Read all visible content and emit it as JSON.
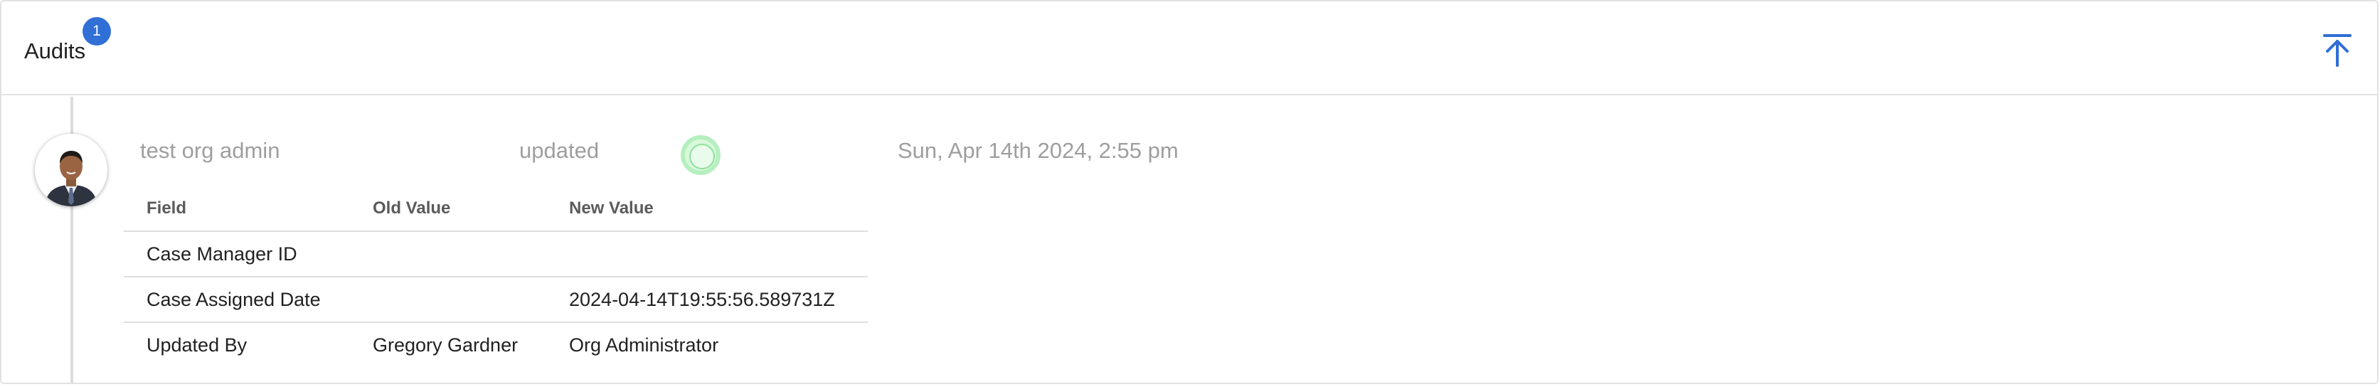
{
  "header": {
    "title": "Audits",
    "badge_count": "1"
  },
  "icons": {
    "collapse": "arrow-up-to-top-icon",
    "avatar": "user-photo",
    "status": "green-status-dot"
  },
  "colors": {
    "badge": "#2f6fd6",
    "collapse_icon": "#2f6fd6",
    "status_dot": "#8fe19b",
    "muted_text": "#9e9e9e"
  },
  "entry": {
    "user": "test org admin",
    "action": "updated",
    "timestamp": "Sun, Apr 14th 2024, 2:55 pm",
    "columns": [
      "Field",
      "Old Value",
      "New Value"
    ],
    "rows": [
      {
        "field": "Case Manager ID",
        "old": "",
        "new": ""
      },
      {
        "field": "Case Assigned Date",
        "old": "",
        "new": "2024-04-14T19:55:56.589731Z"
      },
      {
        "field": "Updated By",
        "old": "Gregory Gardner",
        "new": "Org Administrator"
      }
    ]
  }
}
